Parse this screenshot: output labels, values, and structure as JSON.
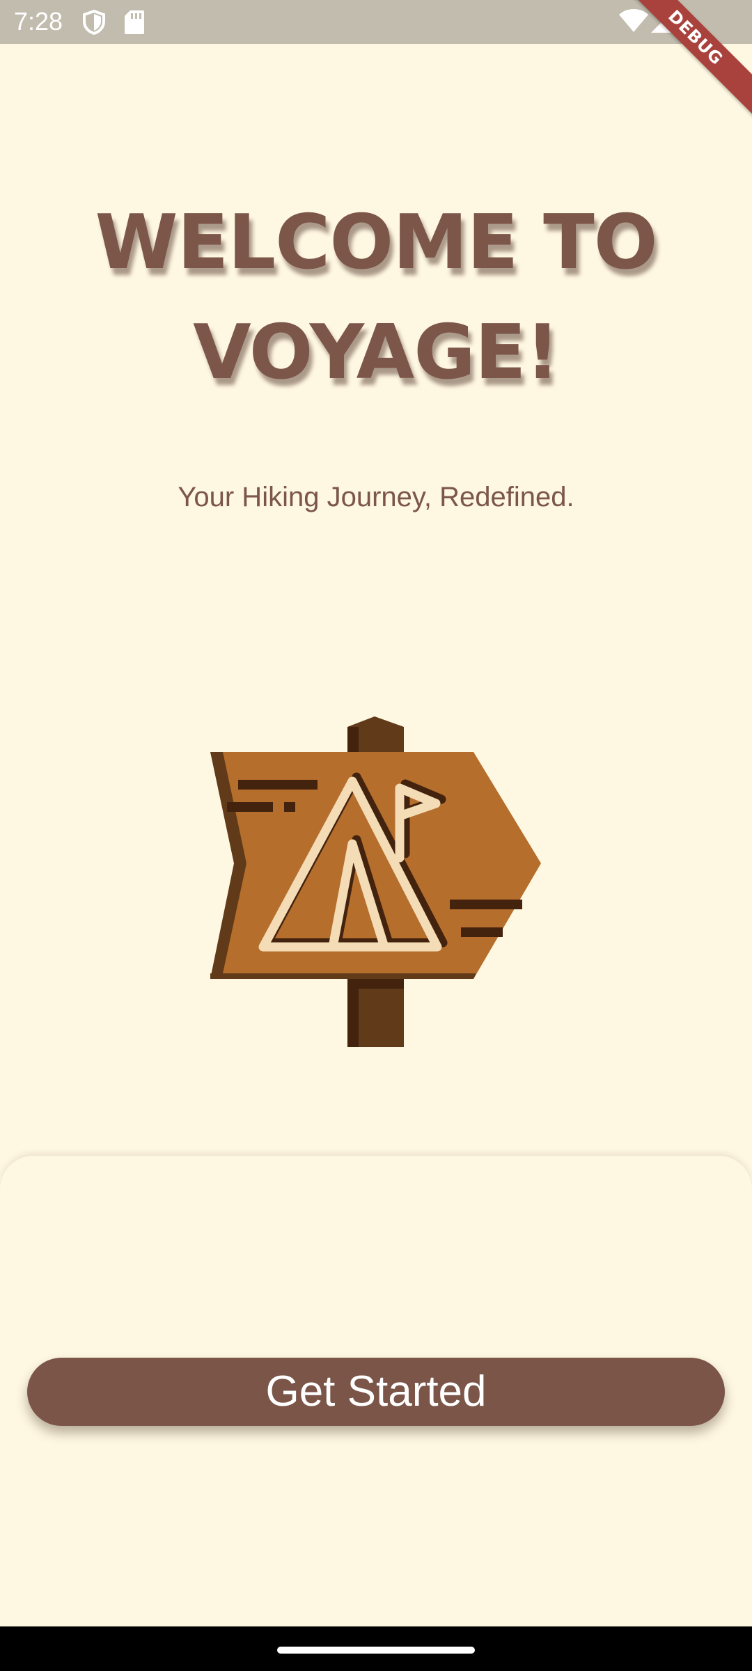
{
  "status_bar": {
    "time": "7:28",
    "icons": [
      "shield-icon",
      "sd-card-icon",
      "wifi-icon",
      "cellular-signal-icon"
    ]
  },
  "debug_banner": {
    "label": "DEBUG",
    "color": "#A9423C"
  },
  "welcome": {
    "title_line1": "WELCOME TO",
    "title_line2": "VOYAGE!",
    "subtitle": "Your Hiking Journey, Redefined."
  },
  "illustration": {
    "icon": "signpost-tent-icon"
  },
  "actions": {
    "get_started_label": "Get Started"
  },
  "colors": {
    "background": "#FEF7E1",
    "brand_brown": "#7B5548",
    "sign_orange": "#B66E2C",
    "post_brown": "#603A19",
    "tent_cream": "#F4DCB6"
  }
}
